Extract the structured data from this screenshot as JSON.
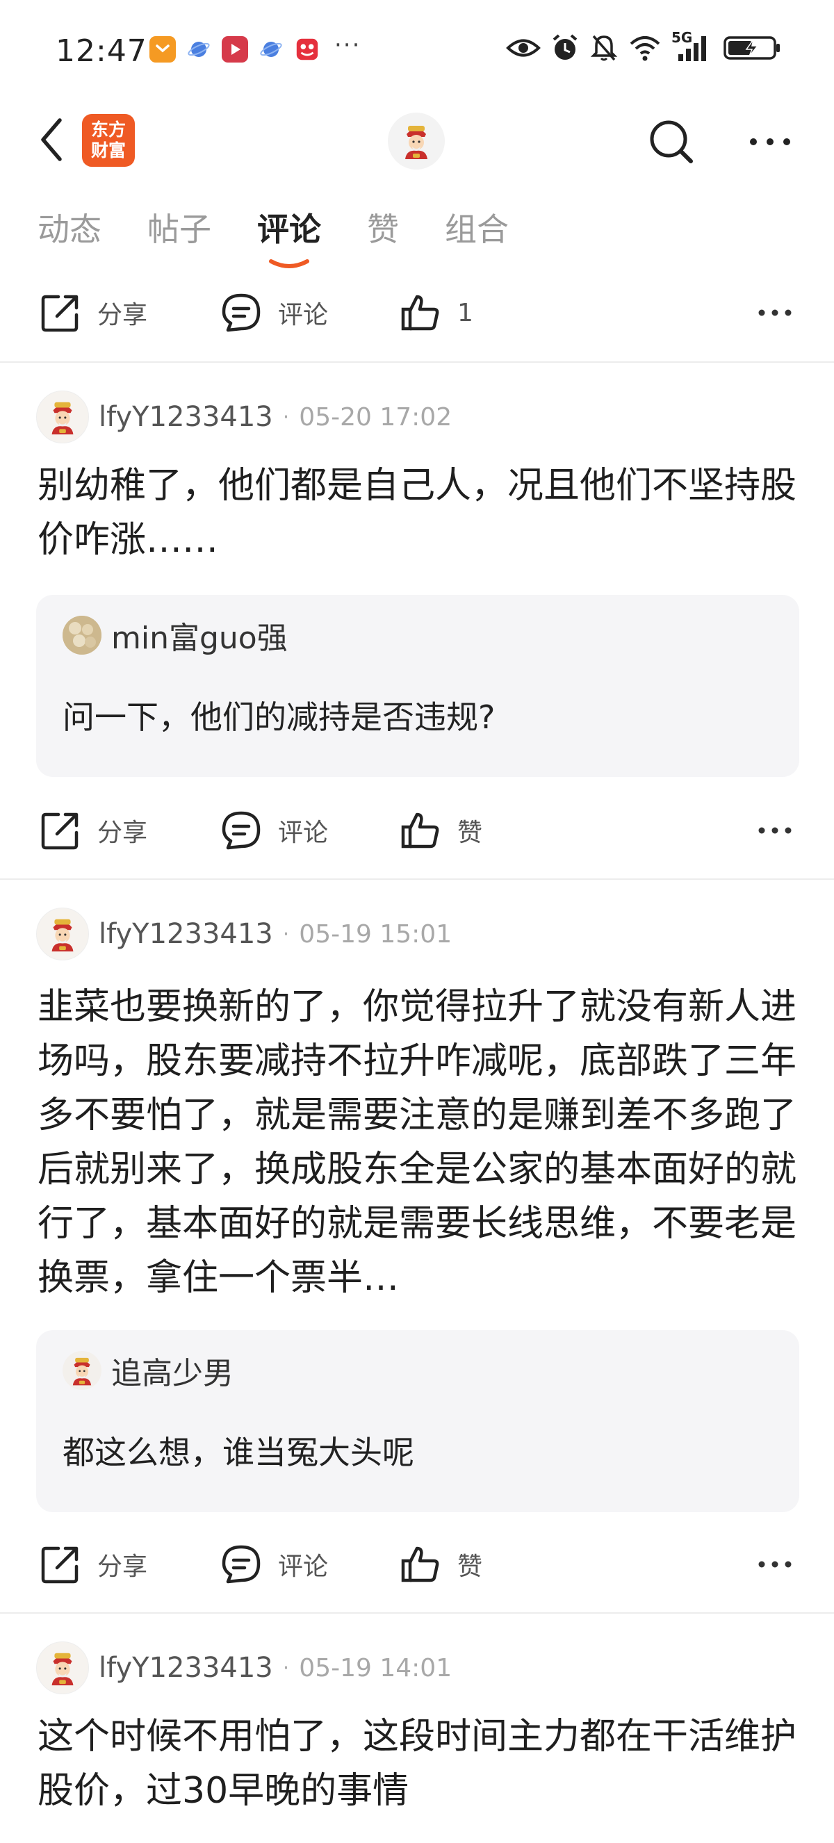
{
  "status_bar": {
    "time": "12:47",
    "more_apps": "···",
    "network": "5G"
  },
  "header": {
    "brand_logo_line1": "东方",
    "brand_logo_line2": "财富"
  },
  "tabs": [
    {
      "label": "动态",
      "active": false
    },
    {
      "label": "帖子",
      "active": false
    },
    {
      "label": "评论",
      "active": true
    },
    {
      "label": "赞",
      "active": false
    },
    {
      "label": "组合",
      "active": false
    }
  ],
  "accent_color": "#ef5a24",
  "top_action_bar": {
    "share_label": "分享",
    "comment_label": "评论",
    "like_label": "1"
  },
  "posts": [
    {
      "username": "lfyY1233413",
      "time": "05-20 17:02",
      "text": "别幼稚了，他们都是自己人，况且他们不坚持股价咋涨……",
      "reply": {
        "username": "min富guo强",
        "text": "问一下，他们的减持是否违规?"
      },
      "share_label": "分享",
      "comment_label": "评论",
      "like_label": "赞"
    },
    {
      "username": "lfyY1233413",
      "time": "05-19 15:01",
      "text": "韭菜也要换新的了，你觉得拉升了就没有新人进场吗，股东要减持不拉升咋减呢，底部跌了三年多不要怕了，就是需要注意的是赚到差不多跑了后就别来了，换成股东全是公家的基本面好的就行了，基本面好的就是需要长线思维，不要老是换票，拿住一个票半…",
      "reply": {
        "username": "追高少男",
        "text": "都这么想，谁当冤大头呢"
      },
      "share_label": "分享",
      "comment_label": "评论",
      "like_label": "赞"
    },
    {
      "username": "lfyY1233413",
      "time": "05-19 14:01",
      "text": "这个时候不用怕了，这段时间主力都在干活维护股价，过30早晚的事情"
    }
  ]
}
